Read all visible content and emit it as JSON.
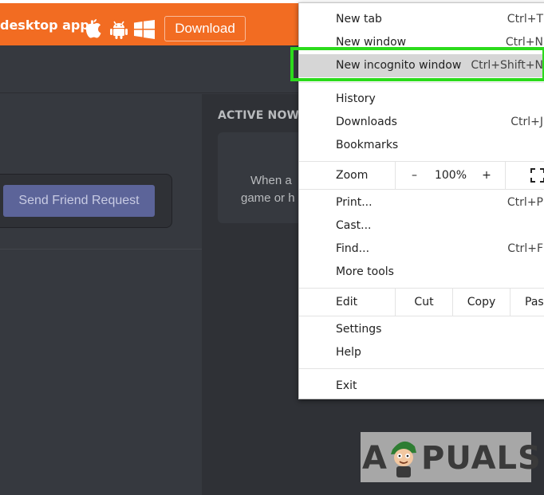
{
  "banner": {
    "text": "desktop app!",
    "download_label": "Download",
    "icons": [
      "apple-icon",
      "android-icon",
      "windows-icon"
    ],
    "color": "#f26c22"
  },
  "discord": {
    "send_friend_request": "Send Friend Request",
    "active_now_title": "ACTIVE NOW",
    "active_card_line1": "When a",
    "active_card_line2": "game or h"
  },
  "menu": {
    "new_tab": {
      "label": "New tab",
      "shortcut": "Ctrl+T"
    },
    "new_window": {
      "label": "New window",
      "shortcut": "Ctrl+N"
    },
    "new_incognito": {
      "label": "New incognito window",
      "shortcut": "Ctrl+Shift+N"
    },
    "history": {
      "label": "History"
    },
    "downloads": {
      "label": "Downloads",
      "shortcut": "Ctrl+J"
    },
    "bookmarks": {
      "label": "Bookmarks"
    },
    "zoom": {
      "label": "Zoom",
      "minus": "–",
      "value": "100%",
      "plus": "+"
    },
    "print": {
      "label": "Print...",
      "shortcut": "Ctrl+P"
    },
    "cast": {
      "label": "Cast..."
    },
    "find": {
      "label": "Find...",
      "shortcut": "Ctrl+F"
    },
    "more_tools": {
      "label": "More tools"
    },
    "edit": {
      "label": "Edit",
      "cut": "Cut",
      "copy": "Copy",
      "paste": "Past"
    },
    "settings": {
      "label": "Settings"
    },
    "help": {
      "label": "Help"
    },
    "exit": {
      "label": "Exit"
    },
    "highlight_color": "#2cdb1c"
  },
  "watermark": {
    "letter_a": "A",
    "rest": "PUALS"
  }
}
